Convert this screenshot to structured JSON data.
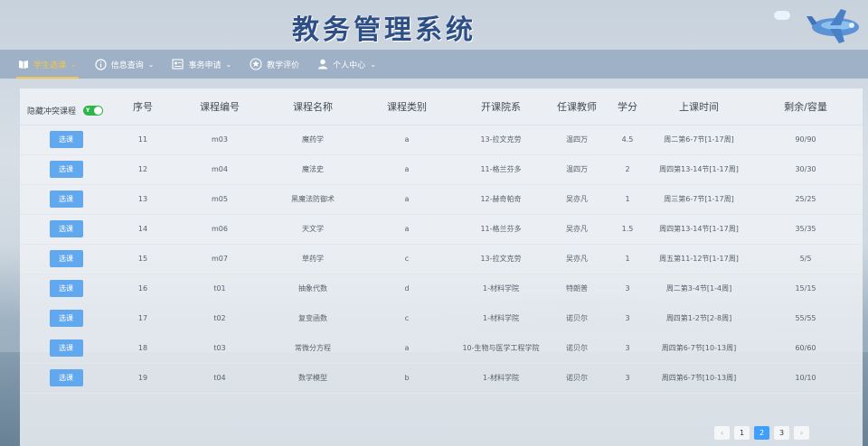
{
  "header": {
    "title": "教务管理系统"
  },
  "nav": [
    {
      "label": "学生选课",
      "icon": "book-icon",
      "caret": "⌄",
      "active": true
    },
    {
      "label": "信息查询",
      "icon": "info-icon",
      "caret": "⌄"
    },
    {
      "label": "事务申请",
      "icon": "document-icon",
      "caret": "⌄"
    },
    {
      "label": "教学评价",
      "icon": "star-icon",
      "caret": ""
    },
    {
      "label": "个人中心",
      "icon": "user-icon",
      "caret": "⌄"
    }
  ],
  "table": {
    "hide_conflict_label": "隐藏冲突课程",
    "toggle_text": "Y",
    "columns": [
      "序号",
      "课程编号",
      "课程名称",
      "课程类别",
      "开课院系",
      "任课教师",
      "学分",
      "上课时间",
      "剩余/容量"
    ],
    "select_label": "选课",
    "rows": [
      {
        "no": "11",
        "code": "m03",
        "name": "魔药学",
        "type": "a",
        "dept": "13-拉文克劳",
        "teacher": "温四万",
        "credit": "4.5",
        "time": "周二第6-7节[1-17周]",
        "cap": "90/90"
      },
      {
        "no": "12",
        "code": "m04",
        "name": "魔法史",
        "type": "a",
        "dept": "11-格兰芬多",
        "teacher": "温四万",
        "credit": "2",
        "time": "周四第13-14节[1-17周]",
        "cap": "30/30"
      },
      {
        "no": "13",
        "code": "m05",
        "name": "黑魔法防御术",
        "type": "a",
        "dept": "12-赫奇帕奇",
        "teacher": "吴亦凡",
        "credit": "1",
        "time": "周三第6-7节[1-17周]",
        "cap": "25/25"
      },
      {
        "no": "14",
        "code": "m06",
        "name": "天文学",
        "type": "a",
        "dept": "11-格兰芬多",
        "teacher": "吴亦凡",
        "credit": "1.5",
        "time": "周四第13-14节[1-17周]",
        "cap": "35/35"
      },
      {
        "no": "15",
        "code": "m07",
        "name": "草药学",
        "type": "c",
        "dept": "13-拉文克劳",
        "teacher": "吴亦凡",
        "credit": "1",
        "time": "周五第11-12节[1-17周]",
        "cap": "5/5"
      },
      {
        "no": "16",
        "code": "t01",
        "name": "抽象代数",
        "type": "d",
        "dept": "1-材料学院",
        "teacher": "特朗普",
        "credit": "3",
        "time": "周二第3-4节[1-4周]",
        "cap": "15/15"
      },
      {
        "no": "17",
        "code": "t02",
        "name": "复变函数",
        "type": "c",
        "dept": "1-材料学院",
        "teacher": "诺贝尔",
        "credit": "3",
        "time": "周四第1-2节[2-8周]",
        "cap": "55/55"
      },
      {
        "no": "18",
        "code": "t03",
        "name": "常微分方程",
        "type": "a",
        "dept": "10-生物与医学工程学院",
        "teacher": "诺贝尔",
        "credit": "3",
        "time": "周四第6-7节[10-13周]",
        "cap": "60/60"
      },
      {
        "no": "19",
        "code": "t04",
        "name": "数学模型",
        "type": "b",
        "dept": "1-材料学院",
        "teacher": "诺贝尔",
        "credit": "3",
        "time": "周四第6-7节[10-13周]",
        "cap": "10/10"
      }
    ]
  },
  "pagination": {
    "prev": "‹",
    "pages": [
      "1",
      "2",
      "3"
    ],
    "current": "2",
    "next": "›"
  },
  "colors": {
    "nav_bg": "#9fb1c7",
    "active": "#f3c648",
    "button": "#62a8ef",
    "title": "#2d4f86",
    "toggle_on": "#2fb54a",
    "page_active": "#409eff"
  }
}
